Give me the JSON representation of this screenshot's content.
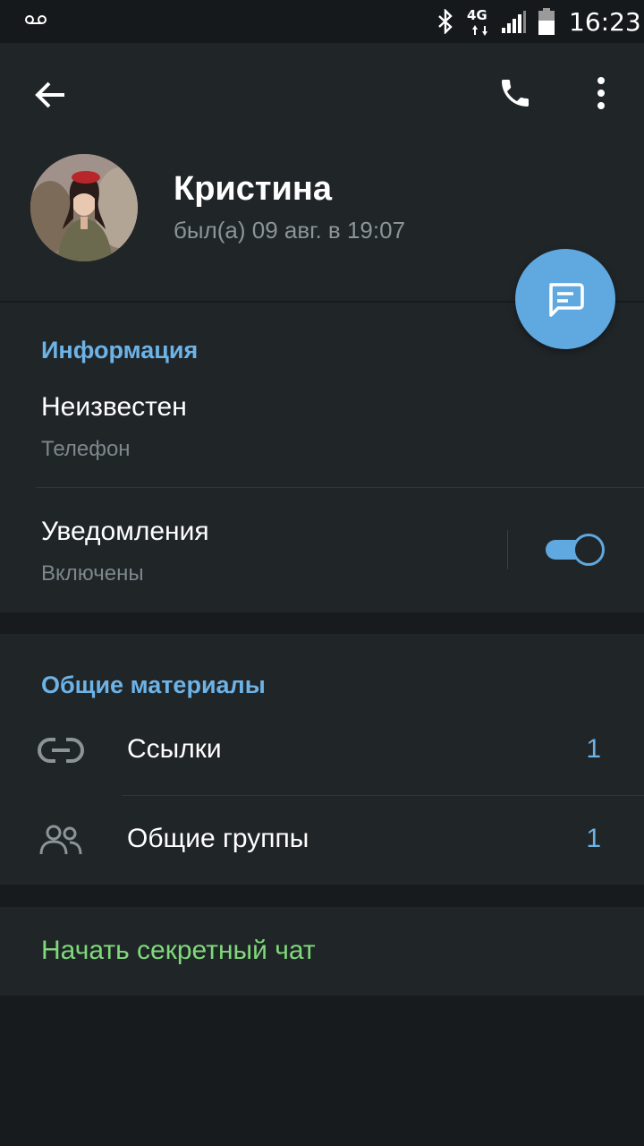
{
  "status_bar": {
    "network": "4G",
    "time": "16:23",
    "icons": [
      "voicemail-icon",
      "bluetooth-icon",
      "signal-icon",
      "battery-icon"
    ]
  },
  "toolbar": {
    "icons": [
      "back-arrow-icon",
      "phone-icon",
      "more-vert-icon"
    ]
  },
  "profile": {
    "name": "Кристина",
    "last_seen": "был(а) 09 авг. в 19:07"
  },
  "fab": {
    "icon": "message-icon",
    "color": "#5fa8e0"
  },
  "info": {
    "title": "Информация",
    "phone_value": "Неизвестен",
    "phone_label": "Телефон",
    "notifications_title": "Уведомления",
    "notifications_status": "Включены",
    "notifications_enabled": true
  },
  "shared": {
    "title": "Общие материалы",
    "items": [
      {
        "label": "Ссылки",
        "count": "1",
        "icon": "link-icon"
      },
      {
        "label": "Общие группы",
        "count": "1",
        "icon": "group-icon"
      }
    ]
  },
  "secret": {
    "label": "Начать секретный чат",
    "color": "#7fd97a"
  },
  "colors": {
    "accent": "#5fa8e0",
    "accent_text": "#6db3e6",
    "background": "#181b1d",
    "surface": "#202528"
  }
}
